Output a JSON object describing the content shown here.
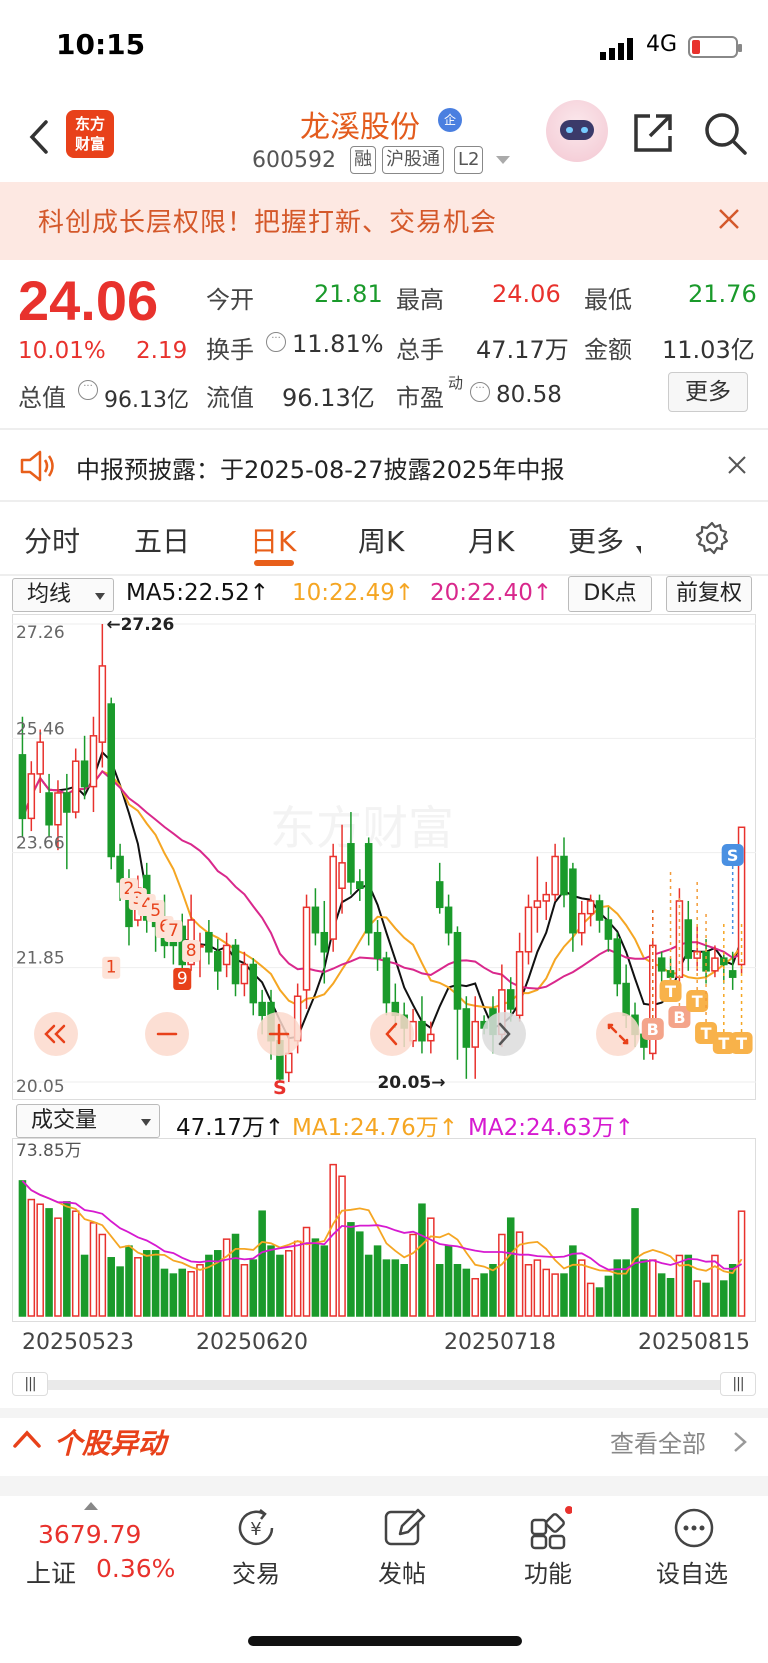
{
  "status_bar": {
    "time": "10:15",
    "network": "4G"
  },
  "header": {
    "app_logo_line1": "东方",
    "app_logo_line2": "财富",
    "stock_name": "龙溪股份",
    "name_badge": "企",
    "stock_code": "600592",
    "tags": [
      "融",
      "沪股通",
      "L2"
    ]
  },
  "banner": {
    "text": "科创成长层权限！把握打新、交易机会"
  },
  "quote": {
    "price": "24.06",
    "change_pct": "10.01%",
    "change": "2.19",
    "open_label": "今开",
    "open": "21.81",
    "high_label": "最高",
    "high": "24.06",
    "low_label": "最低",
    "low": "21.76",
    "turnover_label": "换手",
    "turnover": "11.81%",
    "volume_label": "总手",
    "volume": "47.17万",
    "amount_label": "金额",
    "amount": "11.03亿",
    "total_value_label": "总值",
    "total_value": "96.13亿",
    "float_value_label": "流值",
    "float_value": "96.13亿",
    "pe_label": "市盈",
    "pe_sup": "动",
    "pe": "80.58",
    "more_label": "更多"
  },
  "notice": {
    "text": "中报预披露：于2025-08-27披露2025年中报"
  },
  "tabs": [
    "分时",
    "五日",
    "日K",
    "周K",
    "月K",
    "更多"
  ],
  "ma_row": {
    "selector": "均线",
    "ma5": "MA5:22.52↑",
    "ma10": "10:22.49↑",
    "ma20": "20:22.40↑",
    "dk_label": "DK点",
    "adjust_label": "前复权"
  },
  "volume_row": {
    "selector": "成交量",
    "vol": "47.17万↑",
    "ma1": "MA1:24.76万↑",
    "ma2": "MA2:24.63万↑"
  },
  "colors": {
    "up": "#e8322d",
    "down": "#1a9a2b",
    "ma5": "#111111",
    "ma10": "#f5a623",
    "ma20": "#d9288c",
    "accent": "#e85f1a"
  },
  "chart_data": {
    "type": "candlestick",
    "y_ticks": [
      "27.26",
      "25.46",
      "23.66",
      "21.85",
      "20.05"
    ],
    "ylim": [
      20.05,
      27.26
    ],
    "max_label": "27.26",
    "min_label": "20.05",
    "volume_max_label": "73.85万",
    "dates": [
      "20250523",
      "20250620",
      "20250718",
      "20250815"
    ],
    "candles": [
      [
        25.2,
        24.2,
        25.8,
        23.9
      ],
      [
        24.2,
        24.9,
        25.1,
        24.0
      ],
      [
        24.9,
        25.4,
        25.6,
        24.6
      ],
      [
        24.6,
        24.1,
        24.9,
        23.9
      ],
      [
        24.1,
        24.6,
        24.8,
        23.7
      ],
      [
        24.6,
        24.3,
        24.9,
        23.4
      ],
      [
        24.3,
        25.1,
        25.3,
        24.2
      ],
      [
        25.1,
        24.7,
        25.5,
        24.5
      ],
      [
        24.7,
        25.5,
        25.8,
        24.3
      ],
      [
        25.4,
        26.6,
        27.26,
        25.0
      ],
      [
        26.0,
        23.6,
        26.1,
        23.4
      ],
      [
        23.6,
        23.2,
        23.8,
        22.9
      ],
      [
        23.2,
        22.5,
        23.4,
        22.2
      ],
      [
        22.6,
        23.1,
        23.3,
        22.5
      ],
      [
        23.3,
        22.6,
        23.5,
        22.4
      ],
      [
        22.6,
        22.5,
        22.8,
        22.1
      ],
      [
        22.6,
        22.2,
        23.0,
        22.0
      ],
      [
        22.3,
        22.2,
        22.5,
        21.9
      ],
      [
        22.5,
        21.9,
        22.7,
        21.7
      ],
      [
        21.9,
        22.6,
        23.0,
        21.8
      ],
      [
        22.2,
        22.2,
        22.4,
        21.7
      ],
      [
        22.4,
        22.1,
        22.6,
        21.9
      ],
      [
        22.1,
        21.8,
        22.3,
        21.5
      ],
      [
        21.9,
        22.2,
        22.4,
        21.7
      ],
      [
        22.2,
        21.6,
        22.3,
        21.4
      ],
      [
        21.6,
        21.9,
        22.1,
        21.4
      ],
      [
        21.9,
        21.3,
        22.0,
        21.1
      ],
      [
        21.3,
        21.1,
        21.5,
        20.8
      ],
      [
        21.3,
        20.7,
        21.5,
        20.4
      ],
      [
        20.7,
        20.1,
        20.9,
        20.05
      ],
      [
        20.2,
        20.5,
        20.8,
        20.05
      ],
      [
        20.7,
        21.4,
        21.6,
        20.5
      ],
      [
        21.5,
        22.8,
        23.0,
        21.2
      ],
      [
        22.8,
        22.4,
        23.1,
        22.2
      ],
      [
        22.4,
        22.1,
        22.9,
        21.6
      ],
      [
        22.3,
        23.6,
        23.8,
        22.1
      ],
      [
        23.1,
        23.5,
        24.1,
        22.7
      ],
      [
        23.8,
        23.2,
        24.3,
        23.0
      ],
      [
        23.2,
        23.1,
        23.4,
        22.9
      ],
      [
        23.8,
        22.4,
        23.9,
        22.2
      ],
      [
        22.4,
        22.0,
        22.6,
        21.8
      ],
      [
        22.0,
        21.3,
        22.1,
        21.1
      ],
      [
        21.3,
        21.1,
        21.6,
        20.9
      ],
      [
        21.1,
        20.9,
        21.3,
        20.6
      ],
      [
        20.7,
        21.0,
        21.2,
        20.6
      ],
      [
        21.0,
        20.7,
        21.4,
        20.5
      ],
      [
        20.7,
        20.8,
        21.0,
        20.5
      ],
      [
        23.2,
        22.8,
        23.5,
        22.7
      ],
      [
        22.8,
        22.4,
        23.0,
        22.2
      ],
      [
        22.4,
        21.2,
        22.5,
        20.4
      ],
      [
        21.2,
        20.6,
        21.4,
        20.1
      ],
      [
        20.6,
        21.0,
        21.4,
        20.1
      ],
      [
        21.0,
        20.9,
        21.1,
        20.8
      ],
      [
        21.2,
        20.8,
        21.4,
        20.5
      ],
      [
        20.8,
        21.5,
        21.9,
        20.6
      ],
      [
        21.5,
        21.2,
        21.7,
        21.0
      ],
      [
        21.1,
        22.1,
        22.4,
        21.0
      ],
      [
        22.1,
        22.8,
        23.0,
        21.9
      ],
      [
        22.8,
        22.9,
        23.6,
        22.4
      ],
      [
        22.9,
        23.0,
        23.2,
        22.6
      ],
      [
        23.0,
        23.6,
        23.8,
        22.9
      ],
      [
        23.6,
        23.0,
        23.9,
        22.8
      ],
      [
        23.4,
        22.4,
        23.5,
        22.1
      ],
      [
        22.4,
        22.7,
        22.9,
        22.2
      ],
      [
        22.7,
        22.9,
        23.0,
        22.5
      ],
      [
        22.9,
        22.6,
        23.0,
        22.4
      ],
      [
        22.6,
        22.3,
        22.8,
        22.1
      ],
      [
        22.3,
        21.6,
        22.4,
        21.4
      ],
      [
        21.6,
        21.1,
        21.9,
        20.9
      ],
      [
        21.1,
        20.8,
        21.3,
        20.6
      ],
      [
        20.8,
        20.6,
        21.0,
        20.4
      ],
      [
        20.5,
        22.2,
        22.3,
        20.4
      ],
      [
        22.0,
        21.8,
        22.1,
        21.5
      ],
      [
        21.8,
        21.7,
        22.0,
        21.6
      ],
      [
        21.7,
        22.9,
        23.1,
        21.6
      ],
      [
        22.6,
        22.0,
        22.9,
        21.8
      ],
      [
        22.0,
        22.1,
        22.5,
        21.8
      ],
      [
        22.1,
        21.8,
        22.3,
        21.6
      ],
      [
        21.8,
        22.0,
        22.2,
        21.7
      ],
      [
        22.0,
        21.9,
        22.1,
        21.6
      ],
      [
        21.8,
        21.7,
        22.1,
        21.5
      ],
      [
        21.9,
        24.06,
        24.06,
        21.76
      ]
    ],
    "volumes": [
      58,
      50,
      48,
      46,
      42,
      49,
      45,
      26,
      40,
      35,
      25,
      21,
      30,
      25,
      28,
      28,
      20,
      18,
      20,
      19,
      22,
      26,
      28,
      33,
      35,
      22,
      24,
      45,
      30,
      26,
      28,
      32,
      38,
      33,
      30,
      65,
      60,
      40,
      36,
      26,
      30,
      24,
      24,
      22,
      35,
      48,
      42,
      22,
      30,
      22,
      20,
      16,
      18,
      22,
      35,
      42,
      36,
      22,
      24,
      20,
      18,
      18,
      30,
      24,
      14,
      12,
      17,
      24,
      24,
      46,
      24,
      24,
      18,
      16,
      26,
      26,
      15,
      14,
      26,
      15,
      22,
      45
    ],
    "dk_markers": [
      "1",
      "2",
      "3",
      "4",
      "5",
      "6",
      "7",
      "8",
      "9",
      "S",
      "S",
      "B",
      "B",
      "T",
      "T",
      "T",
      "T",
      "T"
    ]
  },
  "movement": {
    "title": "个股异动",
    "view_all": "查看全部"
  },
  "bottom_nav": {
    "index_value": "3679.79",
    "index_name": "上证",
    "index_pct": "0.36%",
    "trade": "交易",
    "post": "发帖",
    "function": "功能",
    "watchlist": "设自选"
  }
}
